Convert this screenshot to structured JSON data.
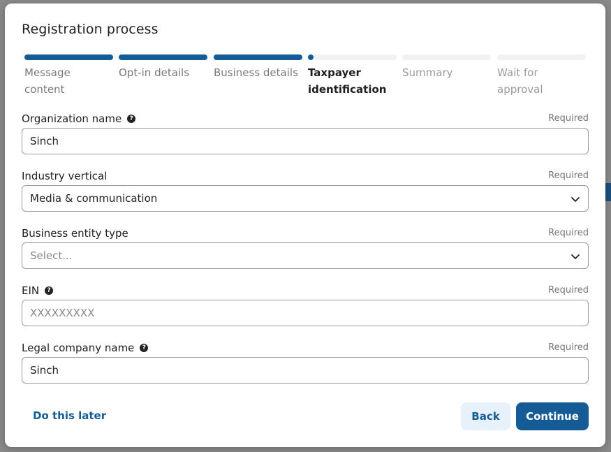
{
  "modal": {
    "title": "Registration process"
  },
  "steps": [
    {
      "label": "Message content",
      "state": "done"
    },
    {
      "label": "Opt-in details",
      "state": "done"
    },
    {
      "label": "Business details",
      "state": "done"
    },
    {
      "label": "Taxpayer identification",
      "state": "current"
    },
    {
      "label": "Summary",
      "state": "future"
    },
    {
      "label": "Wait for approval",
      "state": "future"
    }
  ],
  "fields": {
    "organization_name": {
      "label": "Organization name",
      "required": "Required",
      "value": "Sinch"
    },
    "industry_vertical": {
      "label": "Industry vertical",
      "required": "Required",
      "value": "Media & communication"
    },
    "business_entity_type": {
      "label": "Business entity type",
      "required": "Required",
      "placeholder": "Select..."
    },
    "ein": {
      "label": "EIN",
      "required": "Required",
      "placeholder": "XXXXXXXXX"
    },
    "legal_company_name": {
      "label": "Legal company name",
      "required": "Required",
      "value": "Sinch"
    }
  },
  "footer": {
    "later_label": "Do this later",
    "back_label": "Back",
    "continue_label": "Continue"
  },
  "colors": {
    "accent": "#155c96",
    "back_bg": "#e6f1fb"
  },
  "icons": {
    "help": "question-circle-icon",
    "chevron": "chevron-down-icon"
  }
}
